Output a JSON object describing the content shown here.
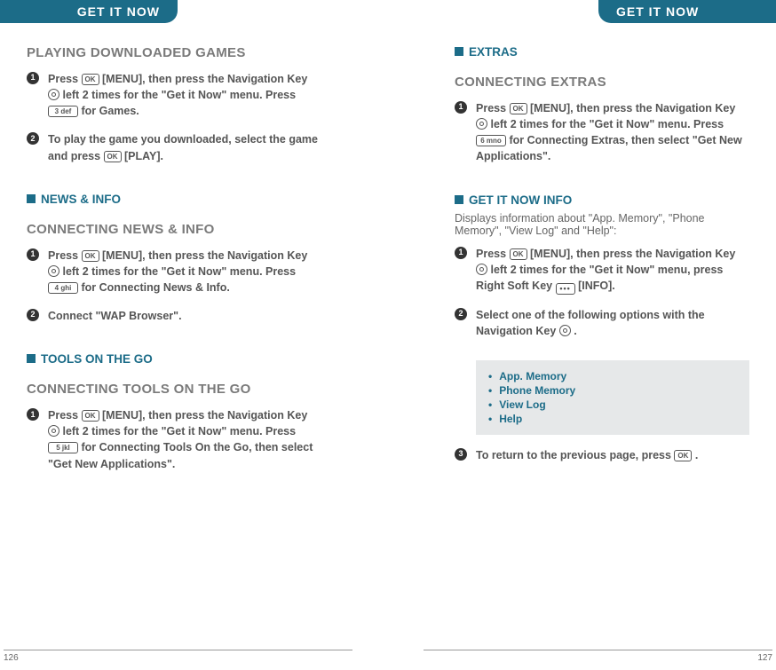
{
  "tabs": {
    "left": "GET IT NOW",
    "right": "GET IT NOW"
  },
  "left": {
    "h_playing": "PLAYING DOWNLOADED GAMES",
    "playing_steps": {
      "s1a": "Press ",
      "s1b": " [MENU], then press the Navigation Key ",
      "s1c": " left 2 times for the \"Get it Now\" menu. Press ",
      "s1d": " for Games.",
      "s2a": "To play the game you downloaded, select the game and press ",
      "s2b": " [PLAY]."
    },
    "sub_news": "NEWS & INFO",
    "h_conn_news": "CONNECTING NEWS & INFO",
    "news_steps": {
      "s1a": "Press ",
      "s1b": " [MENU], then press the Navigation Key ",
      "s1c": " left 2 times for the \"Get it Now\" menu. Press ",
      "s1d": " for Connecting News & Info.",
      "s2": "Connect \"WAP Browser\"."
    },
    "sub_tools": "TOOLS ON THE GO",
    "h_conn_tools": "CONNECTING TOOLS ON THE GO",
    "tools_steps": {
      "s1a": "Press ",
      "s1b": " [MENU], then press the Navigation Key ",
      "s1c": " left 2 times for the \"Get it Now\" menu. Press ",
      "s1d": " for Connecting Tools On the Go, then select \"Get New Applications\"."
    },
    "pageno": "126"
  },
  "right": {
    "sub_extras": "EXTRAS",
    "h_conn_extras": "CONNECTING EXTRAS",
    "extras_steps": {
      "s1a": "Press ",
      "s1b": " [MENU], then press the Navigation Key ",
      "s1c": " left 2 times for the \"Get it Now\" menu. Press ",
      "s1d": " for Connecting Extras, then select \"Get New Applications\"."
    },
    "sub_info": "GET IT NOW INFO",
    "info_lead": "Displays information about \"App. Memory\", \"Phone Memory\", \"View Log\" and \"Help\":",
    "info_steps": {
      "s1a": "Press ",
      "s1b": " [MENU], then press the Navigation Key ",
      "s1c": " left 2 times for the \"Get it Now\" menu, press Right Soft Key ",
      "s1d": " [INFO].",
      "s2a": "Select one of the following options with the Navigation Key ",
      "s2b": " .",
      "s3a": "To return to the previous page, press ",
      "s3b": " ."
    },
    "options": [
      "App. Memory",
      "Phone Memory",
      "View Log",
      "Help"
    ],
    "pageno": "127"
  },
  "keys": {
    "ok": "OK",
    "k3": "3 def",
    "k4": "4 ghi",
    "k5": "5 jkl",
    "k6": "6 mno"
  }
}
